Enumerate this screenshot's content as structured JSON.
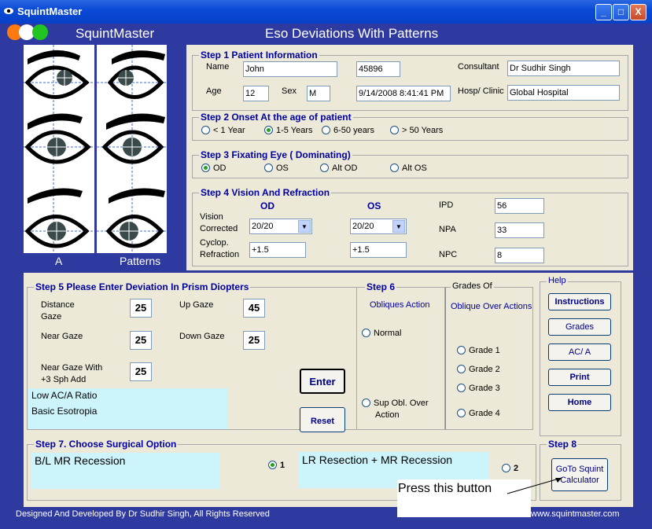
{
  "window": {
    "title": "SquintMaster",
    "minimize": "_",
    "maximize": "□",
    "close": "X"
  },
  "header": {
    "app_name": "SquintMaster",
    "title": "Eso Deviations With Patterns"
  },
  "eye_panel": {
    "label_left": "A",
    "label_right": "Patterns"
  },
  "step1": {
    "legend": "Step 1 Patient  Information",
    "name_label": "Name",
    "name_value": "John",
    "id_value": "45896",
    "consultant_label": "Consultant",
    "consultant_value": "Dr Sudhir Singh",
    "age_label": "Age",
    "age_value": "12",
    "sex_label": "Sex",
    "sex_value": "M",
    "datetime_value": "9/14/2008 8:41:41 PM",
    "hosp_label": "Hosp/ Clinic",
    "hosp_value": "Global Hospital"
  },
  "step2": {
    "legend": "Step 2 Onset At the age of patient",
    "options": [
      "< 1 Year",
      "1-5 Years",
      "6-50 years",
      "> 50 Years"
    ],
    "selected": "1-5 Years"
  },
  "step3": {
    "legend": "Step 3 Fixating Eye  ( Dominating)",
    "options": [
      "OD",
      "OS",
      "Alt OD",
      "Alt OS"
    ],
    "selected": "OD"
  },
  "step4": {
    "legend": "Step 4  Vision And Refraction",
    "od_label": "OD",
    "os_label": "OS",
    "vision_label_1": "Vision",
    "vision_label_2": "Corrected",
    "cyclop_label_1": "Cyclop.",
    "cyclop_label_2": "Refraction",
    "od_vision": "20/20",
    "os_vision": "20/20",
    "od_refraction": "+1.5",
    "os_refraction": "+1.5",
    "ipd_label": "IPD",
    "ipd_value": "56",
    "npa_label": "NPA",
    "npa_value": "33",
    "npc_label": "NPC",
    "npc_value": "8"
  },
  "step5": {
    "legend": "Step 5  Please Enter Deviation In Prism Diopters",
    "distance_label_1": "Distance",
    "distance_label_2": "Gaze",
    "distance_value": "25",
    "up_label": "Up Gaze",
    "up_value": "45",
    "near_label": "Near Gaze",
    "near_value": "25",
    "down_label": "Down Gaze",
    "down_value": "25",
    "near3_label_1": "Near Gaze With",
    "near3_label_2": "+3 Sph Add",
    "near3_value": "25",
    "result1": "Low AC/A Ratio",
    "result2": "Basic Esotropia",
    "enter_label": "Enter",
    "reset_label": "Reset"
  },
  "step6": {
    "title": "Step 6",
    "subtitle": "Obliques Action",
    "normal_label": "Normal",
    "sup_label_1": "Sup Obl. Over",
    "sup_label_2": "Action"
  },
  "grades": {
    "title": "Grades Of",
    "subtitle": "Oblique Over Actions",
    "options": [
      "Grade 1",
      "Grade 2",
      "Grade 3",
      "Grade 4"
    ]
  },
  "help": {
    "title": "Help",
    "buttons": [
      "Instructions",
      "Grades",
      "AC/ A",
      "Print",
      "Home"
    ]
  },
  "step7": {
    "legend": "Step 7.  Choose  Surgical Option",
    "option1": "B/L MR Recession",
    "option1_num": "1",
    "option2": "LR Resection + MR Recession",
    "option2_num": "2",
    "selected": "1"
  },
  "step8": {
    "title": "Step 8",
    "button_1": "GoTo Squint",
    "button_2": "Calculator"
  },
  "callout": {
    "text": "Press this button"
  },
  "footer": {
    "credit": "Designed And Developed By   Dr Sudhir Singh,   All Rights Reserved",
    "website": "www.squintmaster.com"
  },
  "colors": {
    "background": "#3236a0",
    "panel": "#ece9d8",
    "highlight": "#cdf3fb",
    "label_blue": "#0000a0"
  }
}
